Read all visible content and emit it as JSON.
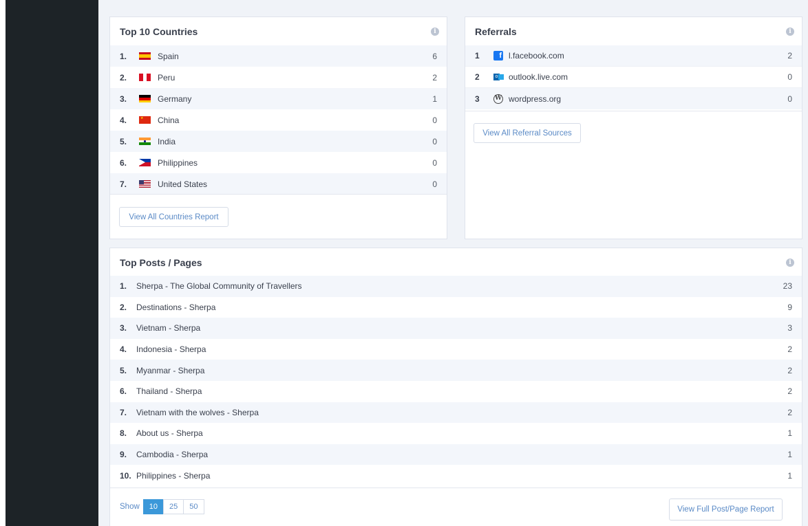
{
  "countries": {
    "title": "Top 10 Countries",
    "rows": [
      {
        "rank": "1.",
        "name": "Spain",
        "value": "6",
        "flag": "es"
      },
      {
        "rank": "2.",
        "name": "Peru",
        "value": "2",
        "flag": "pe"
      },
      {
        "rank": "3.",
        "name": "Germany",
        "value": "1",
        "flag": "de"
      },
      {
        "rank": "4.",
        "name": "China",
        "value": "0",
        "flag": "cn"
      },
      {
        "rank": "5.",
        "name": "India",
        "value": "0",
        "flag": "in"
      },
      {
        "rank": "6.",
        "name": "Philippines",
        "value": "0",
        "flag": "ph"
      },
      {
        "rank": "7.",
        "name": "United States",
        "value": "0",
        "flag": "us"
      }
    ],
    "button": "View All Countries Report"
  },
  "referrals": {
    "title": "Referrals",
    "rows": [
      {
        "rank": "1",
        "name": "l.facebook.com",
        "value": "2",
        "icon": "facebook-icon"
      },
      {
        "rank": "2",
        "name": "outlook.live.com",
        "value": "0",
        "icon": "outlook-icon"
      },
      {
        "rank": "3",
        "name": "wordpress.org",
        "value": "0",
        "icon": "wordpress-icon"
      }
    ],
    "button": "View All Referral Sources"
  },
  "posts": {
    "title": "Top Posts / Pages",
    "rows": [
      {
        "rank": "1.",
        "name": "Sherpa - The Global Community of Travellers",
        "value": "23"
      },
      {
        "rank": "2.",
        "name": "Destinations - Sherpa",
        "value": "9"
      },
      {
        "rank": "3.",
        "name": "Vietnam - Sherpa",
        "value": "3"
      },
      {
        "rank": "4.",
        "name": "Indonesia - Sherpa",
        "value": "2"
      },
      {
        "rank": "5.",
        "name": "Myanmar - Sherpa",
        "value": "2"
      },
      {
        "rank": "6.",
        "name": "Thailand - Sherpa",
        "value": "2"
      },
      {
        "rank": "7.",
        "name": "Vietnam with the wolves - Sherpa",
        "value": "2"
      },
      {
        "rank": "8.",
        "name": "About us - Sherpa",
        "value": "1"
      },
      {
        "rank": "9.",
        "name": "Cambodia - Sherpa",
        "value": "1"
      },
      {
        "rank": "10.",
        "name": "Philippines - Sherpa",
        "value": "1"
      }
    ],
    "pager": {
      "show_label": "Show",
      "options": [
        "10",
        "25",
        "50"
      ],
      "selected": "10"
    },
    "button": "View Full Post/Page Report"
  },
  "colors": {
    "accent": "#3b98d9",
    "link": "#5a8ac6",
    "sidebar": "#1d2327"
  }
}
